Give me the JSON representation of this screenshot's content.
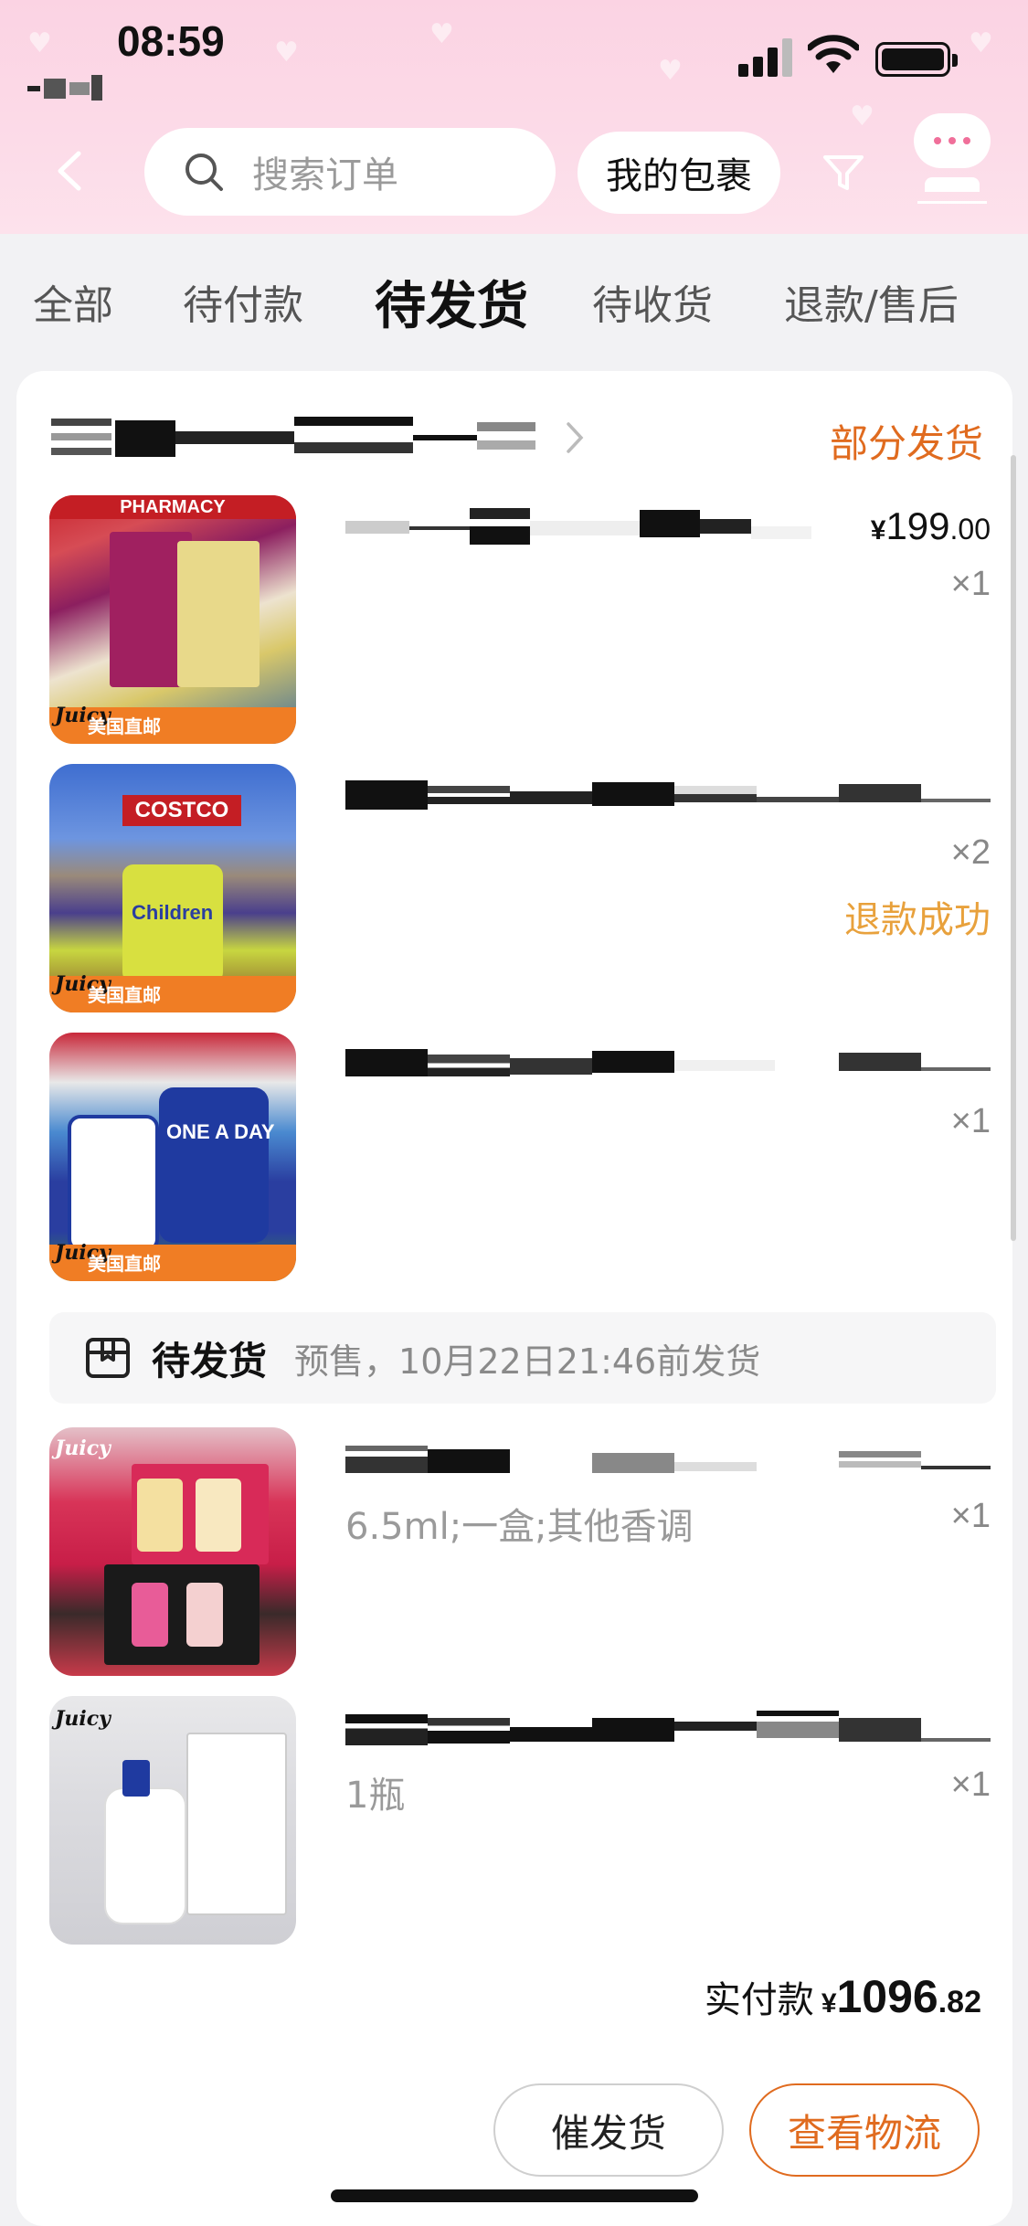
{
  "status_bar": {
    "time": "08:59"
  },
  "search": {
    "placeholder": "搜索订单"
  },
  "header": {
    "package_button": "我的包裹"
  },
  "tabs": [
    {
      "label": "全部",
      "active": false
    },
    {
      "label": "待付款",
      "active": false
    },
    {
      "label": "待发货",
      "active": true
    },
    {
      "label": "待收货",
      "active": false
    },
    {
      "label": "退款/售后",
      "active": false
    }
  ],
  "order": {
    "shop_status": "部分发货",
    "items": [
      {
        "thumb_brand": "Juicy",
        "thumb_band": "美国直邮",
        "price_symbol": "¥",
        "price_int": "199",
        "price_dec": ".00",
        "qty": "×1"
      },
      {
        "thumb_brand": "Juicy",
        "thumb_band": "美国直邮",
        "qty": "×2",
        "status": "退款成功"
      },
      {
        "thumb_brand": "Juicy",
        "thumb_band": "美国直邮",
        "qty": "×1"
      },
      {
        "thumb_brand": "Juicy",
        "spec": "6.5ml;一盒;其他香调",
        "qty": "×1"
      },
      {
        "thumb_brand": "Juicy",
        "spec": "1瓶",
        "qty": "×1"
      }
    ],
    "shipping_group": {
      "status": "待发货",
      "note": "预售，10月22日21:46前发货"
    },
    "total": {
      "label": "实付款",
      "symbol": "¥",
      "int": "1096",
      "dec": ".82"
    },
    "buttons": {
      "urge": "催发货",
      "logistics": "查看物流"
    }
  },
  "colors": {
    "accent_orange": "#e06b1f",
    "refund_yellow": "#e8a13c",
    "header_pink": "#fbd3e3"
  }
}
